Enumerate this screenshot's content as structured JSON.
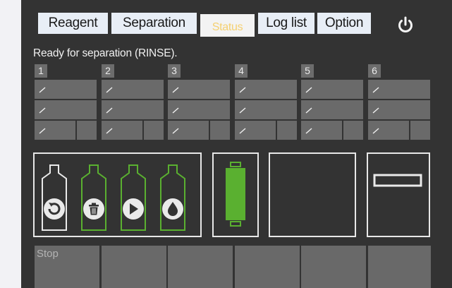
{
  "tabs": [
    {
      "label": "Reagent"
    },
    {
      "label": "Separation"
    },
    {
      "label": "Status",
      "active": true
    },
    {
      "label": "Log list"
    },
    {
      "label": "Option"
    }
  ],
  "power_icon": "power-icon",
  "status_message": "Ready for separation (RINSE).",
  "columns": [
    "1",
    "2",
    "3",
    "4",
    "5",
    "6"
  ],
  "bottles": [
    {
      "icon": "rinse-refresh-icon",
      "color": "#eaeaea"
    },
    {
      "icon": "waste-trash-icon",
      "color": "#5ab030"
    },
    {
      "icon": "play-icon",
      "color": "#5ab030"
    },
    {
      "icon": "drop-icon",
      "color": "#5ab030"
    }
  ],
  "cartridge_color": "#5ab030",
  "bottom_buttons": [
    "Stop",
    "",
    "",
    "",
    "",
    ""
  ],
  "colors": {
    "background": "#333333",
    "cell": "#6a6a6a",
    "accent_green": "#5ab030",
    "active_tab_text": "#f5d070"
  }
}
